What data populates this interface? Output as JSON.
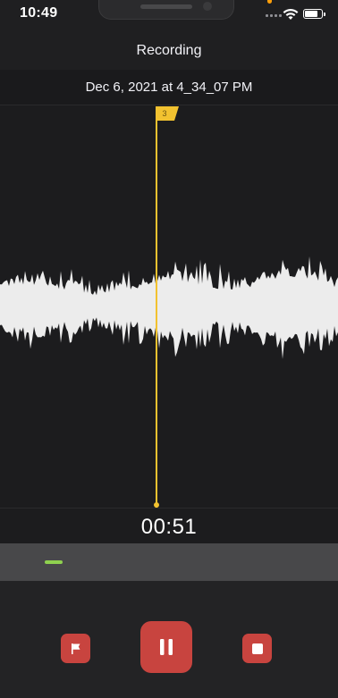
{
  "status_bar": {
    "time": "10:49",
    "battery_level": 0.8
  },
  "header": {
    "title": "Recording",
    "subtitle": "Dec 6, 2021 at 4_34_07 PM"
  },
  "waveform": {
    "marker_label": "3",
    "accent_color": "#f2c230",
    "wave_color": "#ececec"
  },
  "timer": {
    "elapsed": "00:51"
  },
  "overview": {
    "indicator_color": "#8fd14f"
  },
  "controls": {
    "button_color": "#c8443f",
    "flag_icon": "flag-icon",
    "pause_icon": "pause-icon",
    "stop_icon": "stop-icon"
  }
}
